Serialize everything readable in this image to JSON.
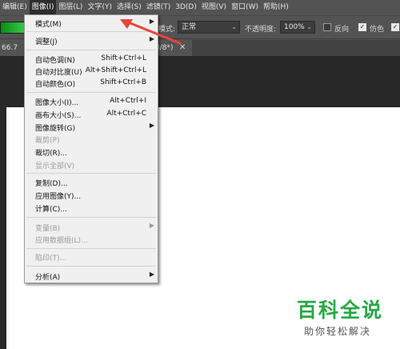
{
  "menubar": {
    "items": [
      {
        "label": "编辑(E)"
      },
      {
        "label": "图像(I)"
      },
      {
        "label": "图层(L)"
      },
      {
        "label": "文字(Y)"
      },
      {
        "label": "选择(S)"
      },
      {
        "label": "滤镜(T)"
      },
      {
        "label": "3D(D)"
      },
      {
        "label": "视图(V)"
      },
      {
        "label": "窗口(W)"
      },
      {
        "label": "帮助(H)"
      }
    ]
  },
  "options": {
    "mode_label": "模式:",
    "mode_value": "正常",
    "opacity_label": "不透明度:",
    "opacity_value": "100%",
    "reverse_label": "反向",
    "dither_label": "仿色",
    "dither_checked": true,
    "reverse_checked": false,
    "transparency_checked": true
  },
  "tabs": {
    "doc_left": "66.7",
    "doc_right": "3/8*)"
  },
  "image_menu": {
    "items": [
      {
        "label": "模式(M)",
        "shortcut": "",
        "submenu": true,
        "disabled": false
      },
      {
        "label": "调整(J)",
        "shortcut": "",
        "submenu": true,
        "disabled": false
      },
      {
        "label": "自动色调(N)",
        "shortcut": "Shift+Ctrl+L",
        "submenu": false,
        "disabled": false
      },
      {
        "label": "自动对比度(U)",
        "shortcut": "Alt+Shift+Ctrl+L",
        "submenu": false,
        "disabled": false
      },
      {
        "label": "自动颜色(O)",
        "shortcut": "Shift+Ctrl+B",
        "submenu": false,
        "disabled": false
      },
      {
        "label": "图像大小(I)...",
        "shortcut": "Alt+Ctrl+I",
        "submenu": false,
        "disabled": false
      },
      {
        "label": "画布大小(S)...",
        "shortcut": "Alt+Ctrl+C",
        "submenu": false,
        "disabled": false
      },
      {
        "label": "图像旋转(G)",
        "shortcut": "",
        "submenu": true,
        "disabled": false
      },
      {
        "label": "裁剪(P)",
        "shortcut": "",
        "submenu": false,
        "disabled": true
      },
      {
        "label": "裁切(R)...",
        "shortcut": "",
        "submenu": false,
        "disabled": false
      },
      {
        "label": "显示全部(V)",
        "shortcut": "",
        "submenu": false,
        "disabled": true
      },
      {
        "label": "复制(D)...",
        "shortcut": "",
        "submenu": false,
        "disabled": false
      },
      {
        "label": "应用图像(Y)...",
        "shortcut": "",
        "submenu": false,
        "disabled": false
      },
      {
        "label": "计算(C)...",
        "shortcut": "",
        "submenu": false,
        "disabled": false
      },
      {
        "label": "变量(B)",
        "shortcut": "",
        "submenu": true,
        "disabled": true
      },
      {
        "label": "应用数据组(L)...",
        "shortcut": "",
        "submenu": false,
        "disabled": true
      },
      {
        "label": "陷印(T)...",
        "shortcut": "",
        "submenu": false,
        "disabled": true
      },
      {
        "label": "分析(A)",
        "shortcut": "",
        "submenu": true,
        "disabled": false
      }
    ]
  },
  "watermark": {
    "title": "百科全说",
    "subtitle": "助你轻松解决"
  },
  "icons": {
    "submenu": "triangle-right-icon",
    "dropdown": "chevron-down-icon",
    "close": "close-icon",
    "checkbox": "checkbox-icon"
  },
  "colors": {
    "annotation_arrow": "#e8453c",
    "watermark_green": "#27a844",
    "gradient_start": "#0a8c14",
    "gradient_end": "#3bd04a"
  }
}
